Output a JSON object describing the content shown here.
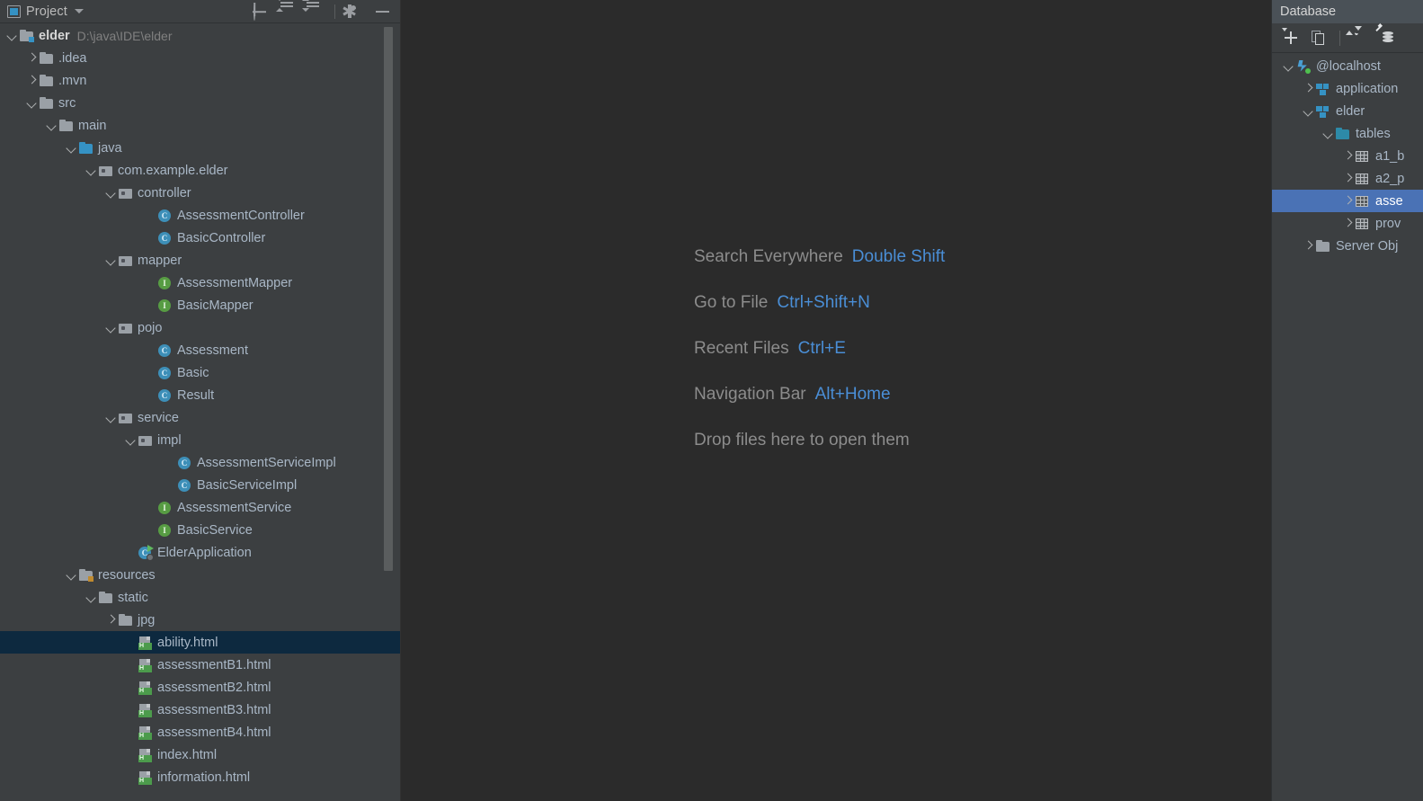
{
  "project_panel": {
    "title": "Project",
    "title_icon": "project-window-icon",
    "dropdown_icon": "chevron-down-icon",
    "toolbar": [
      {
        "name": "select-opened-file-button",
        "icon": "target-crosshair-icon"
      },
      {
        "name": "expand-all-button",
        "icon": "expand-all-icon"
      },
      {
        "name": "collapse-all-button",
        "icon": "collapse-all-icon"
      },
      {
        "name": "settings-button",
        "icon": "gear-icon"
      },
      {
        "name": "hide-panel-button",
        "icon": "minimize-icon"
      }
    ],
    "tree": [
      {
        "label": "elder",
        "path": "D:\\java\\IDE\\elder",
        "indent": 0,
        "state": "open",
        "icon": "module-folder",
        "bold": true
      },
      {
        "label": ".idea",
        "indent": 1,
        "state": "closed",
        "icon": "folder"
      },
      {
        "label": ".mvn",
        "indent": 1,
        "state": "closed",
        "icon": "folder"
      },
      {
        "label": "src",
        "indent": 1,
        "state": "open",
        "icon": "folder"
      },
      {
        "label": "main",
        "indent": 2,
        "state": "open",
        "icon": "folder"
      },
      {
        "label": "java",
        "indent": 3,
        "state": "open",
        "icon": "source-folder"
      },
      {
        "label": "com.example.elder",
        "indent": 4,
        "state": "open",
        "icon": "package"
      },
      {
        "label": "controller",
        "indent": 5,
        "state": "open",
        "icon": "package"
      },
      {
        "label": "AssessmentController",
        "indent": 7,
        "state": "none",
        "icon": "class"
      },
      {
        "label": "BasicController",
        "indent": 7,
        "state": "none",
        "icon": "class"
      },
      {
        "label": "mapper",
        "indent": 5,
        "state": "open",
        "icon": "package"
      },
      {
        "label": "AssessmentMapper",
        "indent": 7,
        "state": "none",
        "icon": "interface"
      },
      {
        "label": "BasicMapper",
        "indent": 7,
        "state": "none",
        "icon": "interface"
      },
      {
        "label": "pojo",
        "indent": 5,
        "state": "open",
        "icon": "package"
      },
      {
        "label": "Assessment",
        "indent": 7,
        "state": "none",
        "icon": "class"
      },
      {
        "label": "Basic",
        "indent": 7,
        "state": "none",
        "icon": "class"
      },
      {
        "label": "Result",
        "indent": 7,
        "state": "none",
        "icon": "class"
      },
      {
        "label": "service",
        "indent": 5,
        "state": "open",
        "icon": "package"
      },
      {
        "label": "impl",
        "indent": 6,
        "state": "open",
        "icon": "package"
      },
      {
        "label": "AssessmentServiceImpl",
        "indent": 8,
        "state": "none",
        "icon": "class"
      },
      {
        "label": "BasicServiceImpl",
        "indent": 8,
        "state": "none",
        "icon": "class"
      },
      {
        "label": "AssessmentService",
        "indent": 7,
        "state": "none",
        "icon": "interface"
      },
      {
        "label": "BasicService",
        "indent": 7,
        "state": "none",
        "icon": "interface"
      },
      {
        "label": "ElderApplication",
        "indent": 6,
        "state": "none",
        "icon": "runnable-class"
      },
      {
        "label": "resources",
        "indent": 3,
        "state": "open",
        "icon": "resource-folder"
      },
      {
        "label": "static",
        "indent": 4,
        "state": "open",
        "icon": "folder"
      },
      {
        "label": "jpg",
        "indent": 5,
        "state": "closed",
        "icon": "folder"
      },
      {
        "label": "ability.html",
        "indent": 6,
        "state": "none",
        "icon": "html-file",
        "selected": true
      },
      {
        "label": "assessmentB1.html",
        "indent": 6,
        "state": "none",
        "icon": "html-file"
      },
      {
        "label": "assessmentB2.html",
        "indent": 6,
        "state": "none",
        "icon": "html-file"
      },
      {
        "label": "assessmentB3.html",
        "indent": 6,
        "state": "none",
        "icon": "html-file"
      },
      {
        "label": "assessmentB4.html",
        "indent": 6,
        "state": "none",
        "icon": "html-file"
      },
      {
        "label": "index.html",
        "indent": 6,
        "state": "none",
        "icon": "html-file"
      },
      {
        "label": "information.html",
        "indent": 6,
        "state": "none",
        "icon": "html-file"
      }
    ]
  },
  "editor": {
    "hints": [
      {
        "action": "Search Everywhere",
        "shortcut": "Double Shift"
      },
      {
        "action": "Go to File",
        "shortcut": "Ctrl+Shift+N"
      },
      {
        "action": "Recent Files",
        "shortcut": "Ctrl+E"
      },
      {
        "action": "Navigation Bar",
        "shortcut": "Alt+Home"
      },
      {
        "action": "Drop files here to open them",
        "shortcut": ""
      }
    ]
  },
  "database_panel": {
    "title": "Database",
    "toolbar": [
      {
        "name": "new-datasource-button",
        "icon": "plus-dropdown-icon"
      },
      {
        "name": "duplicate-button",
        "icon": "copy-icon"
      },
      {
        "name": "refresh-button",
        "icon": "refresh-icon"
      },
      {
        "name": "data-sources-properties-button",
        "icon": "database-wrench-icon"
      },
      {
        "name": "stop-button",
        "icon": "stop-icon"
      }
    ],
    "tree": [
      {
        "label": "@localhost",
        "indent": 0,
        "state": "open",
        "icon": "connection"
      },
      {
        "label": "application",
        "indent": 1,
        "state": "closed",
        "icon": "schema"
      },
      {
        "label": "elder",
        "indent": 1,
        "state": "open",
        "icon": "schema"
      },
      {
        "label": "tables",
        "indent": 2,
        "state": "open",
        "icon": "folder-teal"
      },
      {
        "label": "a1_b",
        "indent": 3,
        "state": "closed",
        "icon": "table"
      },
      {
        "label": "a2_p",
        "indent": 3,
        "state": "closed",
        "icon": "table"
      },
      {
        "label": "asse",
        "indent": 3,
        "state": "closed",
        "icon": "table",
        "selected": true
      },
      {
        "label": "prov",
        "indent": 3,
        "state": "closed",
        "icon": "table"
      },
      {
        "label": "Server Obj",
        "indent": 1,
        "state": "closed",
        "icon": "folder"
      }
    ]
  },
  "colors": {
    "panel_bg": "#3c3f41",
    "editor_bg": "#2b2b2b",
    "text": "#a9b7c6",
    "muted_text": "#808080",
    "selection_inactive": "#0d293f",
    "selection_active": "#4a72b5",
    "accent_blue": "#4a8ed6",
    "class_icon": "#3d8fb8",
    "interface_icon": "#579c43",
    "html_tag": "#4c9b4c",
    "stop_red": "#d45b5b"
  }
}
